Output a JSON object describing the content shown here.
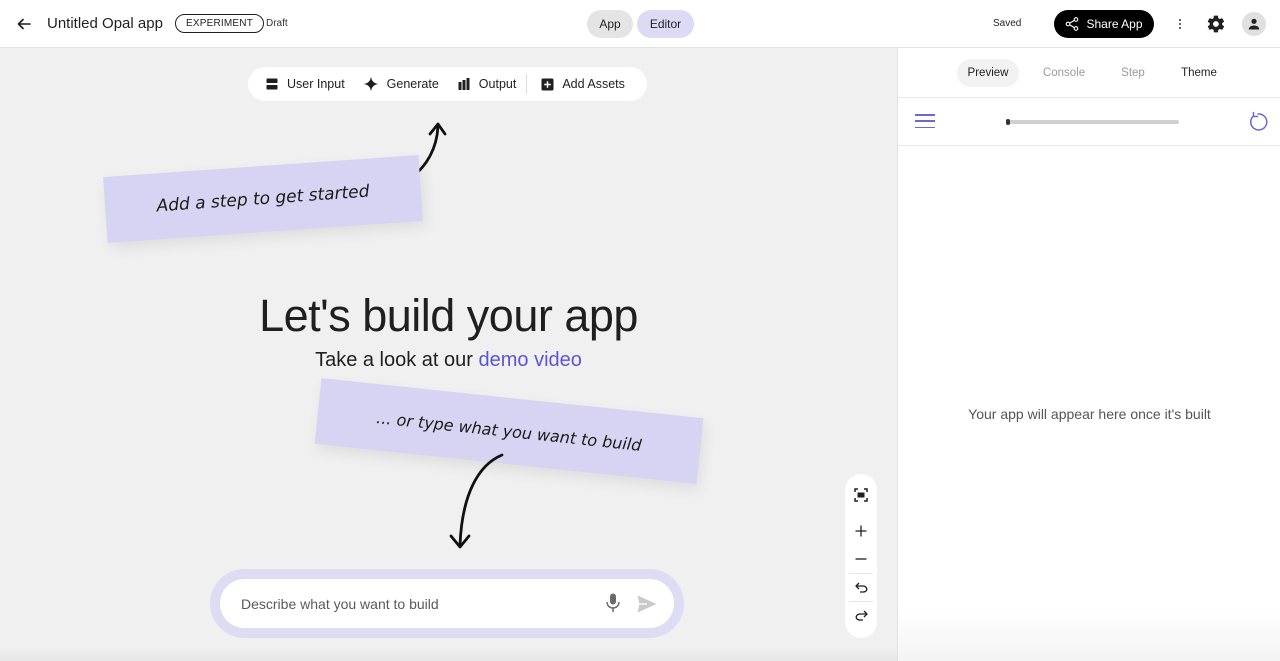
{
  "header": {
    "app_title": "Untitled Opal app",
    "badge": "EXPERIMENT",
    "status": "Draft",
    "mode_app": "App",
    "mode_editor": "Editor",
    "saved": "Saved",
    "share_label": "Share App",
    "icons": [
      "arrow-back-icon",
      "share-icon",
      "more-vert-icon",
      "gear-icon",
      "person-icon"
    ]
  },
  "toolbar": {
    "items": [
      {
        "label": "User Input",
        "icon": "user-input-icon"
      },
      {
        "label": "Generate",
        "icon": "sparkle-icon"
      },
      {
        "label": "Output",
        "icon": "output-icon"
      },
      {
        "label": "Add Assets",
        "icon": "add-box-icon"
      }
    ]
  },
  "notes": {
    "top": "Add a step to get started",
    "bottom": "... or type what you want to build"
  },
  "hero": {
    "title": "Let's build your app",
    "subtitle_prefix": "Take a look at our ",
    "subtitle_link": "demo video"
  },
  "prompt": {
    "placeholder": "Describe what you want to build"
  },
  "zoom_controls": [
    "fit-screen-icon",
    "zoom-in-icon",
    "zoom-out-icon",
    "undo-icon",
    "redo-icon"
  ],
  "right_panel": {
    "tabs": [
      "Preview",
      "Console",
      "Step",
      "Theme"
    ],
    "active_tab": "Preview",
    "progress": 0.02,
    "empty_message": "Your app will appear here once it's built"
  },
  "colors": {
    "accent": "#5b55d6",
    "editor_active": "#dcdaf5",
    "sticky_note": "#d6d4f2",
    "canvas_bg": "#f0f0f0"
  }
}
